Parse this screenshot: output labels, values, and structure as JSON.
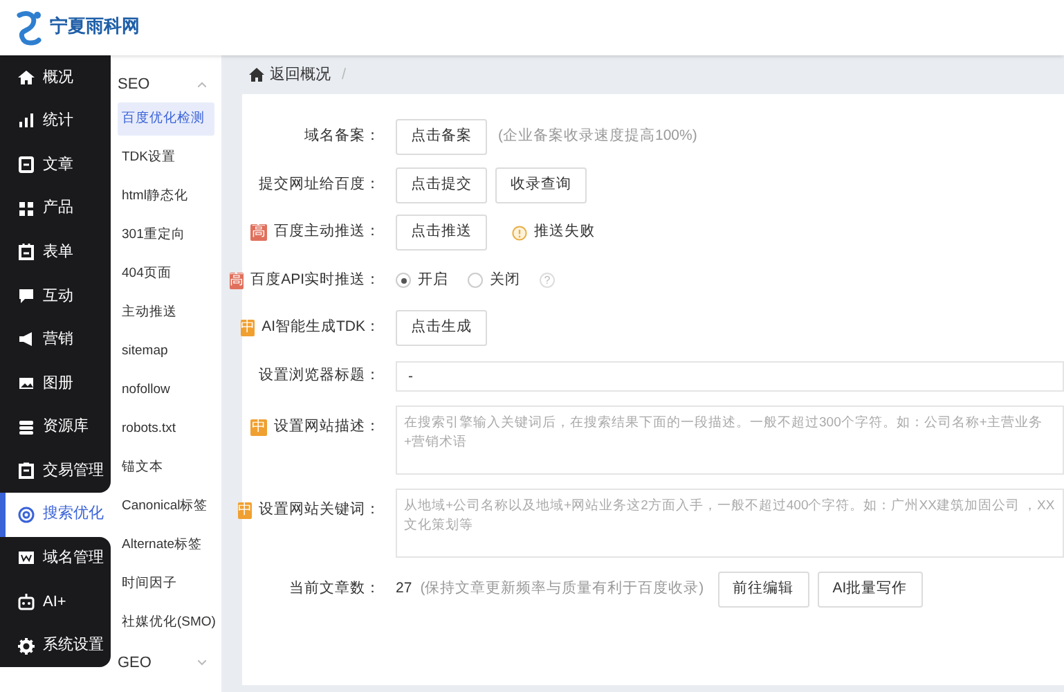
{
  "header": {
    "logo_text": "宁夏雨科网"
  },
  "nav": [
    {
      "label": "概况",
      "selected": false
    },
    {
      "label": "统计",
      "selected": false
    },
    {
      "label": "文章",
      "selected": false
    },
    {
      "label": "产品",
      "selected": false
    },
    {
      "label": "表单",
      "selected": false
    },
    {
      "label": "互动",
      "selected": false
    },
    {
      "label": "营销",
      "selected": false
    },
    {
      "label": "图册",
      "selected": false
    },
    {
      "label": "资源库",
      "selected": false
    },
    {
      "label": "交易管理",
      "selected": false
    },
    {
      "label": "搜索优化",
      "selected": true
    },
    {
      "label": "域名管理",
      "selected": false
    },
    {
      "label": "AI+",
      "selected": false
    },
    {
      "label": "系统设置",
      "selected": false
    }
  ],
  "submenu": [
    {
      "title": "SEO",
      "expanded": true,
      "items": [
        {
          "label": "百度优化检测",
          "selected": true
        },
        {
          "label": "TDK设置",
          "selected": false
        },
        {
          "label": "html静态化",
          "selected": false
        },
        {
          "label": "301重定向",
          "selected": false
        },
        {
          "label": "404页面",
          "selected": false
        },
        {
          "label": "主动推送",
          "selected": false
        },
        {
          "label": "sitemap",
          "selected": false
        },
        {
          "label": "nofollow",
          "selected": false
        },
        {
          "label": "robots.txt",
          "selected": false
        },
        {
          "label": "锚文本",
          "selected": false
        },
        {
          "label": "Canonical标签",
          "selected": false
        },
        {
          "label": "Alternate标签",
          "selected": false
        },
        {
          "label": "时间因子",
          "selected": false
        },
        {
          "label": "社媒优化(SMO)",
          "selected": false
        }
      ]
    },
    {
      "title": "GEO",
      "expanded": false
    }
  ],
  "breadcrumb": {
    "label": "返回概况",
    "separator": "/"
  },
  "form": [
    {
      "kind": "buttons",
      "label": "域名备案：",
      "buttons": [
        "点击备案"
      ],
      "note": "(企业备案收录速度提高100%)"
    },
    {
      "kind": "buttons",
      "label": "提交网址给百度：",
      "buttons": [
        "点击提交",
        "收录查询"
      ]
    },
    {
      "kind": "buttons",
      "badge": {
        "text": "高",
        "color": "#e0705c"
      },
      "label": "百度主动推送：",
      "buttons": [
        "点击推送"
      ],
      "status": "推送失败"
    },
    {
      "kind": "radio",
      "badge": {
        "text": "高",
        "color": "#e0705c"
      },
      "label": "百度API实时推送：",
      "options": [
        {
          "label": "开启",
          "selected": true
        },
        {
          "label": "关闭",
          "selected": false
        }
      ],
      "help": "?"
    },
    {
      "kind": "buttons",
      "badge": {
        "text": "中",
        "color": "#f0a030"
      },
      "label": "AI智能生成TDK：",
      "buttons": [
        "点击生成"
      ]
    },
    {
      "kind": "input",
      "label": "设置浏览器标题：",
      "value": "-"
    },
    {
      "kind": "textarea",
      "badge": {
        "text": "中",
        "color": "#f0a030"
      },
      "label": "设置网站描述：",
      "placeholder": "在搜索引擎输入关键词后，在搜索结果下面的一段描述。一般不超过300个字符。如：公司名称+主营业务+营销术语"
    },
    {
      "kind": "textarea",
      "badge": {
        "text": "中",
        "color": "#f0a030"
      },
      "label": "设置网站关键词：",
      "placeholder": "从地域+公司名称以及地域+网站业务这2方面入手，一般不超过400个字符。如：广州XX建筑加固公司 ，XX文化策划等"
    },
    {
      "kind": "count",
      "label": "当前文章数：",
      "value": "27",
      "note": "(保持文章更新频率与质量有利于百度收录)",
      "buttons": [
        "前往编辑",
        "AI批量写作"
      ]
    }
  ]
}
